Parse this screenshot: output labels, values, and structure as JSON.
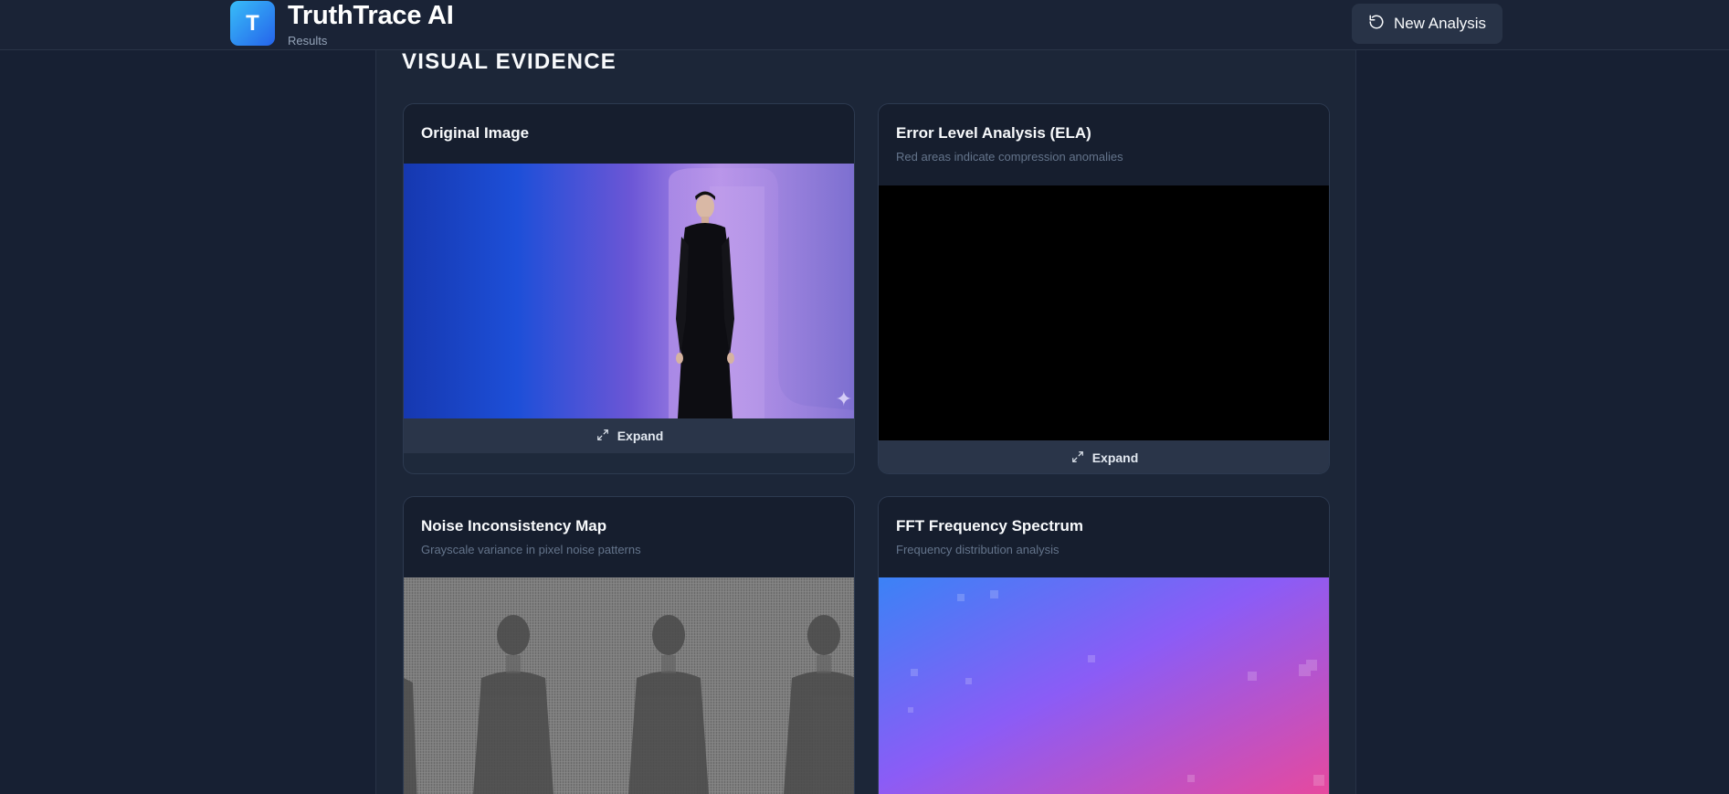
{
  "header": {
    "logo_letter": "T",
    "app_title": "TruthTrace AI",
    "app_subtitle": "Results",
    "new_analysis_label": "New Analysis"
  },
  "section": {
    "title": "VISUAL EVIDENCE"
  },
  "cards": {
    "original": {
      "title": "Original Image",
      "expand_label": "Expand"
    },
    "ela": {
      "title": "Error Level Analysis (ELA)",
      "description": "Red areas indicate compression anomalies",
      "expand_label": "Expand"
    },
    "noise": {
      "title": "Noise Inconsistency Map",
      "description": "Grayscale variance in pixel noise patterns"
    },
    "fft": {
      "title": "FFT Frequency Spectrum",
      "description": "Frequency distribution analysis"
    }
  },
  "colors": {
    "background": "#172033",
    "card": "#1e293b",
    "accent_blue": "#38bdf8",
    "fft_gradient": [
      "#3b82f6",
      "#8b5cf6",
      "#ec4899"
    ]
  },
  "icons": {
    "new_analysis": "rotate-ccw-icon",
    "expand": "maximize-icon",
    "watermark": "sparkle-icon"
  }
}
